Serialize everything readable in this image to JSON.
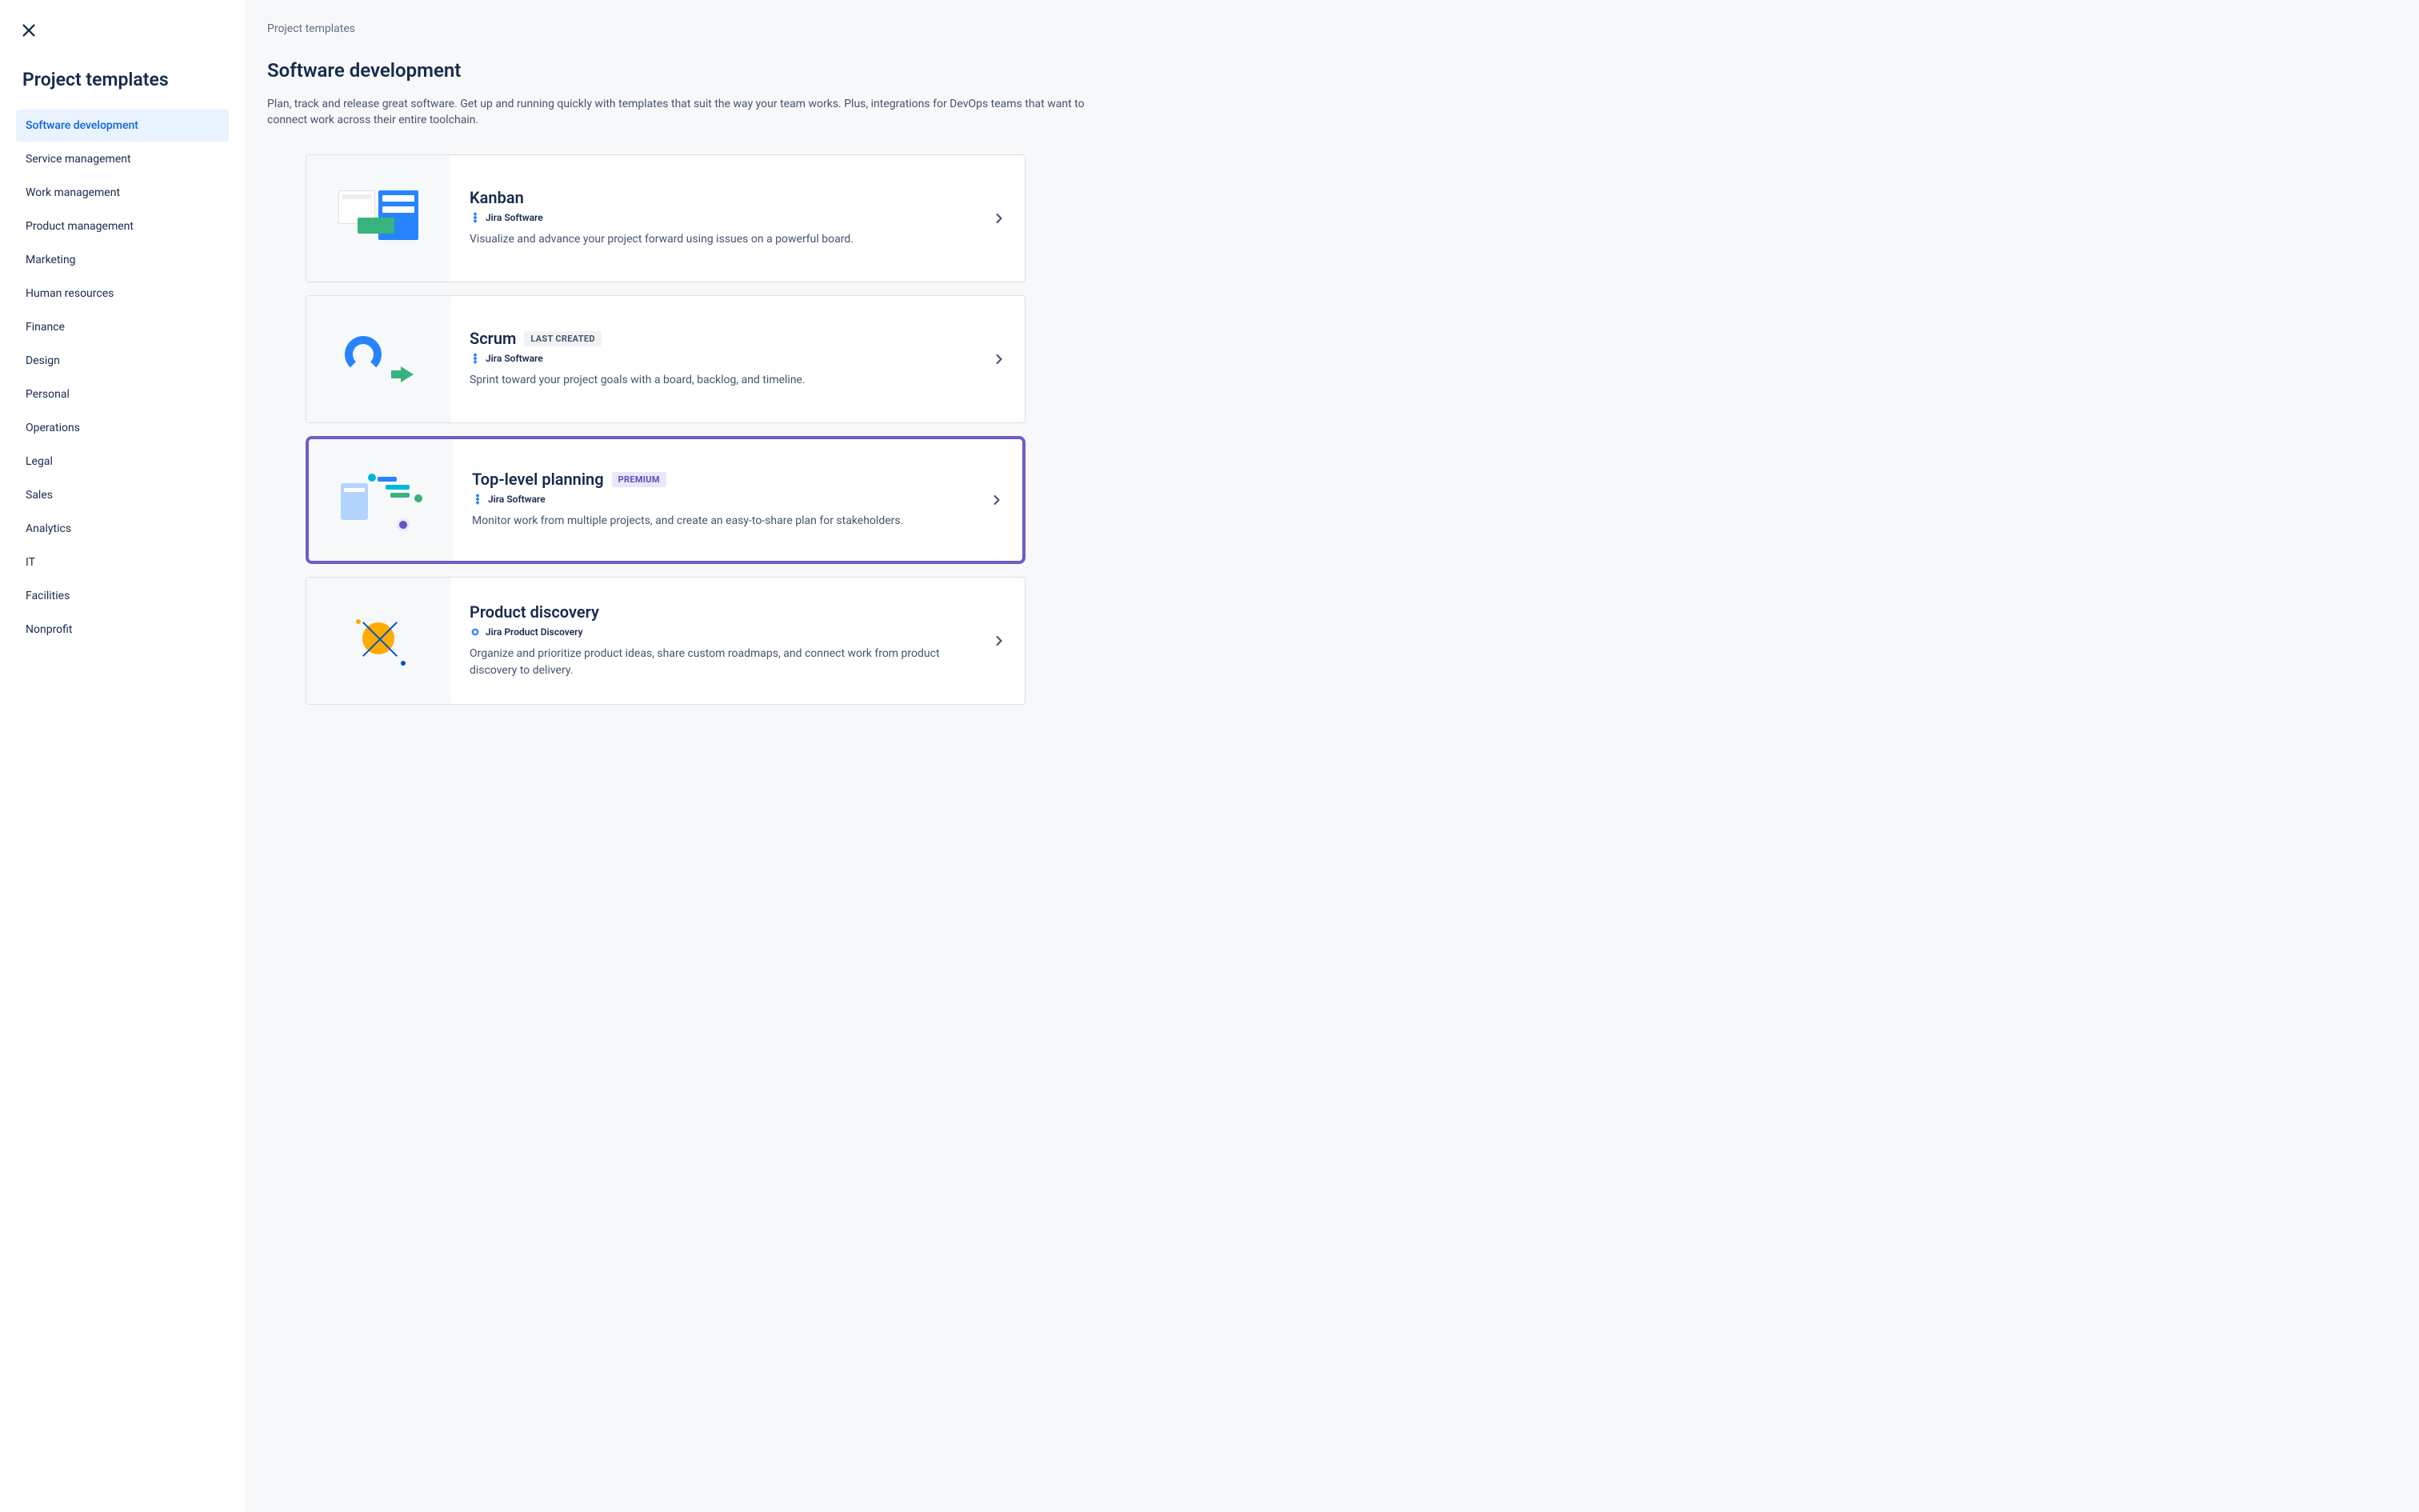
{
  "sidebar": {
    "title": "Project templates",
    "items": [
      {
        "label": "Software development",
        "active": true
      },
      {
        "label": "Service management",
        "active": false
      },
      {
        "label": "Work management",
        "active": false
      },
      {
        "label": "Product management",
        "active": false
      },
      {
        "label": "Marketing",
        "active": false
      },
      {
        "label": "Human resources",
        "active": false
      },
      {
        "label": "Finance",
        "active": false
      },
      {
        "label": "Design",
        "active": false
      },
      {
        "label": "Personal",
        "active": false
      },
      {
        "label": "Operations",
        "active": false
      },
      {
        "label": "Legal",
        "active": false
      },
      {
        "label": "Sales",
        "active": false
      },
      {
        "label": "Analytics",
        "active": false
      },
      {
        "label": "IT",
        "active": false
      },
      {
        "label": "Facilities",
        "active": false
      },
      {
        "label": "Nonprofit",
        "active": false
      }
    ]
  },
  "main": {
    "breadcrumb": "Project templates",
    "title": "Software development",
    "description": "Plan, track and release great software. Get up and running quickly with templates that suit the way your team works. Plus, integrations for DevOps teams that want to connect work across their entire toolchain.",
    "templates": [
      {
        "title": "Kanban",
        "product": "Jira Software",
        "product_icon": "jira-software",
        "description": "Visualize and advance your project forward using issues on a powerful board.",
        "badge": null,
        "highlight": false,
        "illus": "kanban"
      },
      {
        "title": "Scrum",
        "product": "Jira Software",
        "product_icon": "jira-software",
        "description": "Sprint toward your project goals with a board, backlog, and timeline.",
        "badge": {
          "text": "LAST CREATED",
          "type": "last"
        },
        "highlight": false,
        "illus": "scrum"
      },
      {
        "title": "Top-level planning",
        "product": "Jira Software",
        "product_icon": "jira-software",
        "description": "Monitor work from multiple projects, and create an easy-to-share plan for stakeholders.",
        "badge": {
          "text": "PREMIUM",
          "type": "premium"
        },
        "highlight": true,
        "illus": "top"
      },
      {
        "title": "Product discovery",
        "product": "Jira Product Discovery",
        "product_icon": "jira-discovery",
        "description": "Organize and prioritize product ideas, share custom roadmaps, and connect work from product discovery to delivery.",
        "badge": null,
        "highlight": false,
        "illus": "discovery"
      }
    ]
  }
}
